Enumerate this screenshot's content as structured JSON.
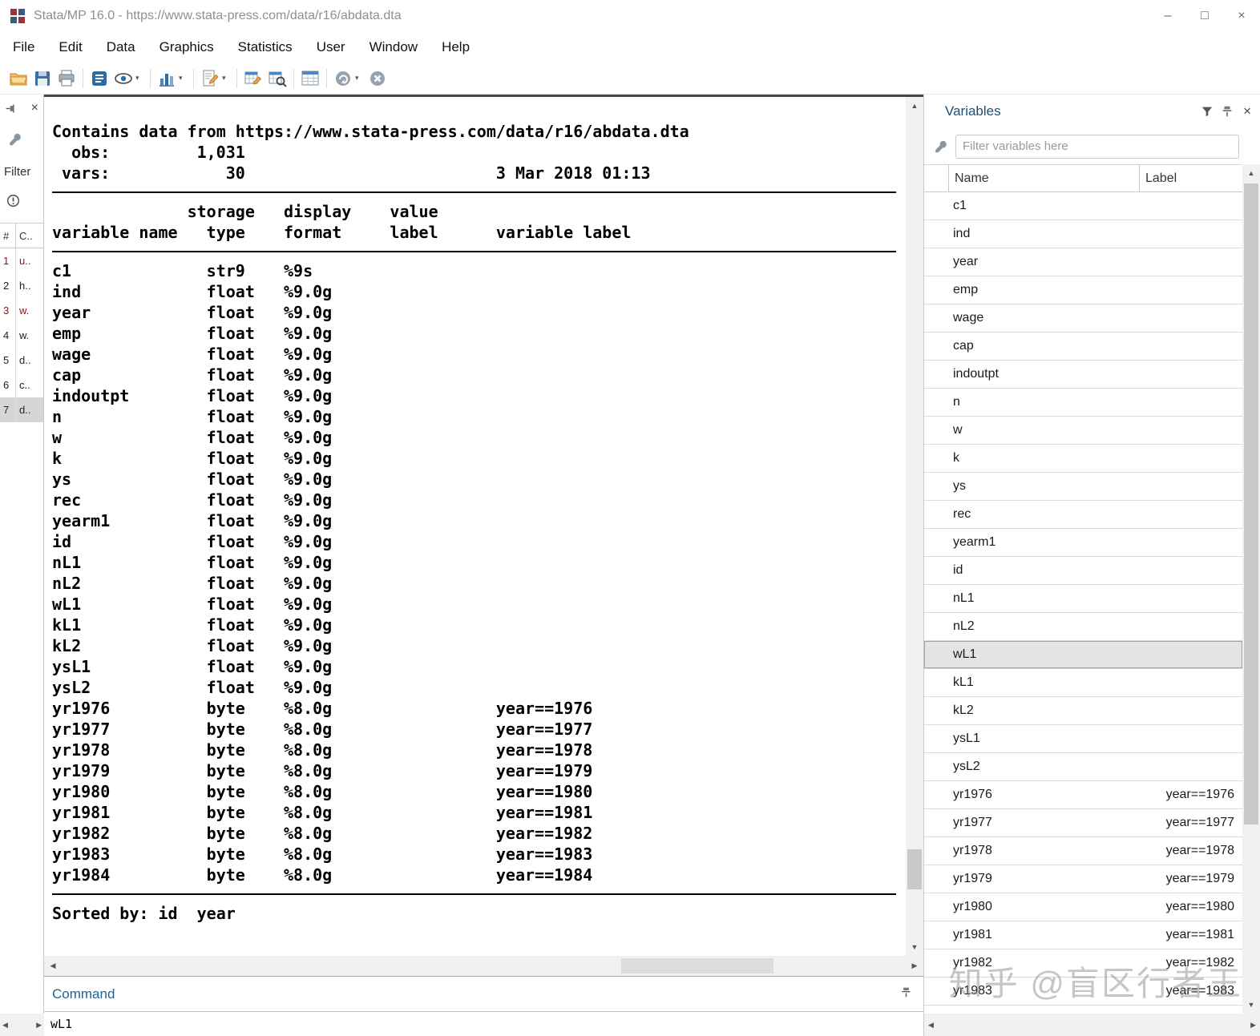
{
  "window": {
    "title": "Stata/MP 16.0 - https://www.stata-press.com/data/r16/abdata.dta",
    "controls": [
      {
        "name": "minimize",
        "glyph": "–"
      },
      {
        "name": "maximize",
        "glyph": "□"
      },
      {
        "name": "close",
        "glyph": "×"
      }
    ]
  },
  "glyphs": {
    "caret": "▾",
    "scroll_up": "▲",
    "scroll_down": "▼",
    "scroll_left": "◀",
    "scroll_right": "▶",
    "close": "×"
  },
  "menu": {
    "items": [
      "File",
      "Edit",
      "Data",
      "Graphics",
      "Statistics",
      "User",
      "Window",
      "Help"
    ]
  },
  "toolbar": {
    "buttons": [
      "open",
      "save",
      "print",
      "log",
      "viewer",
      "graph",
      "do-file-editor",
      "data-editor",
      "data-browser",
      "variables-manager",
      "more",
      "break"
    ]
  },
  "history_panel": {
    "filter_label": "Filter",
    "columns": {
      "num": "#",
      "command": "C.."
    },
    "rows": [
      {
        "num": "1",
        "cmd": "u..",
        "red": true
      },
      {
        "num": "2",
        "cmd": "h.."
      },
      {
        "num": "3",
        "cmd": "w.",
        "red": true
      },
      {
        "num": "4",
        "cmd": "w."
      },
      {
        "num": "5",
        "cmd": "d.."
      },
      {
        "num": "6",
        "cmd": "c.."
      },
      {
        "num": "7",
        "cmd": "d..",
        "selected": true
      }
    ]
  },
  "results": {
    "contains_line": "Contains data from https://www.stata-press.com/data/r16/abdata.dta",
    "obs": {
      "label": "obs:",
      "value": "1,031"
    },
    "vars": {
      "label": "vars:",
      "value": "30",
      "date": "3 Mar 2018 01:13"
    },
    "header1": {
      "type": "storage",
      "format": "display",
      "vlabel": "value"
    },
    "header2": {
      "name": "variable name",
      "type": "type",
      "format": "format",
      "vlabel": "label",
      "varlabel": "variable label"
    },
    "variables": [
      {
        "name": "c1",
        "type": "str9",
        "format": "%9s"
      },
      {
        "name": "ind",
        "type": "float",
        "format": "%9.0g"
      },
      {
        "name": "year",
        "type": "float",
        "format": "%9.0g"
      },
      {
        "name": "emp",
        "type": "float",
        "format": "%9.0g"
      },
      {
        "name": "wage",
        "type": "float",
        "format": "%9.0g"
      },
      {
        "name": "cap",
        "type": "float",
        "format": "%9.0g"
      },
      {
        "name": "indoutpt",
        "type": "float",
        "format": "%9.0g"
      },
      {
        "name": "n",
        "type": "float",
        "format": "%9.0g"
      },
      {
        "name": "w",
        "type": "float",
        "format": "%9.0g"
      },
      {
        "name": "k",
        "type": "float",
        "format": "%9.0g"
      },
      {
        "name": "ys",
        "type": "float",
        "format": "%9.0g"
      },
      {
        "name": "rec",
        "type": "float",
        "format": "%9.0g"
      },
      {
        "name": "yearm1",
        "type": "float",
        "format": "%9.0g"
      },
      {
        "name": "id",
        "type": "float",
        "format": "%9.0g"
      },
      {
        "name": "nL1",
        "type": "float",
        "format": "%9.0g"
      },
      {
        "name": "nL2",
        "type": "float",
        "format": "%9.0g"
      },
      {
        "name": "wL1",
        "type": "float",
        "format": "%9.0g"
      },
      {
        "name": "kL1",
        "type": "float",
        "format": "%9.0g"
      },
      {
        "name": "kL2",
        "type": "float",
        "format": "%9.0g"
      },
      {
        "name": "ysL1",
        "type": "float",
        "format": "%9.0g"
      },
      {
        "name": "ysL2",
        "type": "float",
        "format": "%9.0g"
      },
      {
        "name": "yr1976",
        "type": "byte",
        "format": "%8.0g",
        "varlabel": "year==1976"
      },
      {
        "name": "yr1977",
        "type": "byte",
        "format": "%8.0g",
        "varlabel": "year==1977"
      },
      {
        "name": "yr1978",
        "type": "byte",
        "format": "%8.0g",
        "varlabel": "year==1978"
      },
      {
        "name": "yr1979",
        "type": "byte",
        "format": "%8.0g",
        "varlabel": "year==1979"
      },
      {
        "name": "yr1980",
        "type": "byte",
        "format": "%8.0g",
        "varlabel": "year==1980"
      },
      {
        "name": "yr1981",
        "type": "byte",
        "format": "%8.0g",
        "varlabel": "year==1981"
      },
      {
        "name": "yr1982",
        "type": "byte",
        "format": "%8.0g",
        "varlabel": "year==1982"
      },
      {
        "name": "yr1983",
        "type": "byte",
        "format": "%8.0g",
        "varlabel": "year==1983"
      },
      {
        "name": "yr1984",
        "type": "byte",
        "format": "%8.0g",
        "varlabel": "year==1984"
      }
    ],
    "sorted_by": {
      "label": "Sorted by:",
      "value": "id  year"
    }
  },
  "variables_panel": {
    "title": "Variables",
    "filter_placeholder": "Filter variables here",
    "columns": {
      "name": "Name",
      "label": "Label"
    },
    "rows": [
      {
        "name": "c1",
        "label": ""
      },
      {
        "name": "ind",
        "label": ""
      },
      {
        "name": "year",
        "label": ""
      },
      {
        "name": "emp",
        "label": ""
      },
      {
        "name": "wage",
        "label": ""
      },
      {
        "name": "cap",
        "label": ""
      },
      {
        "name": "indoutpt",
        "label": ""
      },
      {
        "name": "n",
        "label": ""
      },
      {
        "name": "w",
        "label": ""
      },
      {
        "name": "k",
        "label": ""
      },
      {
        "name": "ys",
        "label": ""
      },
      {
        "name": "rec",
        "label": ""
      },
      {
        "name": "yearm1",
        "label": ""
      },
      {
        "name": "id",
        "label": ""
      },
      {
        "name": "nL1",
        "label": ""
      },
      {
        "name": "nL2",
        "label": ""
      },
      {
        "name": "wL1",
        "label": "",
        "selected": true
      },
      {
        "name": "kL1",
        "label": ""
      },
      {
        "name": "kL2",
        "label": ""
      },
      {
        "name": "ysL1",
        "label": ""
      },
      {
        "name": "ysL2",
        "label": ""
      },
      {
        "name": "yr1976",
        "label": "year==1976"
      },
      {
        "name": "yr1977",
        "label": "year==1977"
      },
      {
        "name": "yr1978",
        "label": "year==1978"
      },
      {
        "name": "yr1979",
        "label": "year==1979"
      },
      {
        "name": "yr1980",
        "label": "year==1980"
      },
      {
        "name": "yr1981",
        "label": "year==1981"
      },
      {
        "name": "yr1982",
        "label": "year==1982"
      },
      {
        "name": "yr1983",
        "label": "year==1983"
      }
    ]
  },
  "command_panel": {
    "title": "Command",
    "value": "wL1"
  },
  "watermark": {
    "text": "知乎 @盲区行者王"
  }
}
